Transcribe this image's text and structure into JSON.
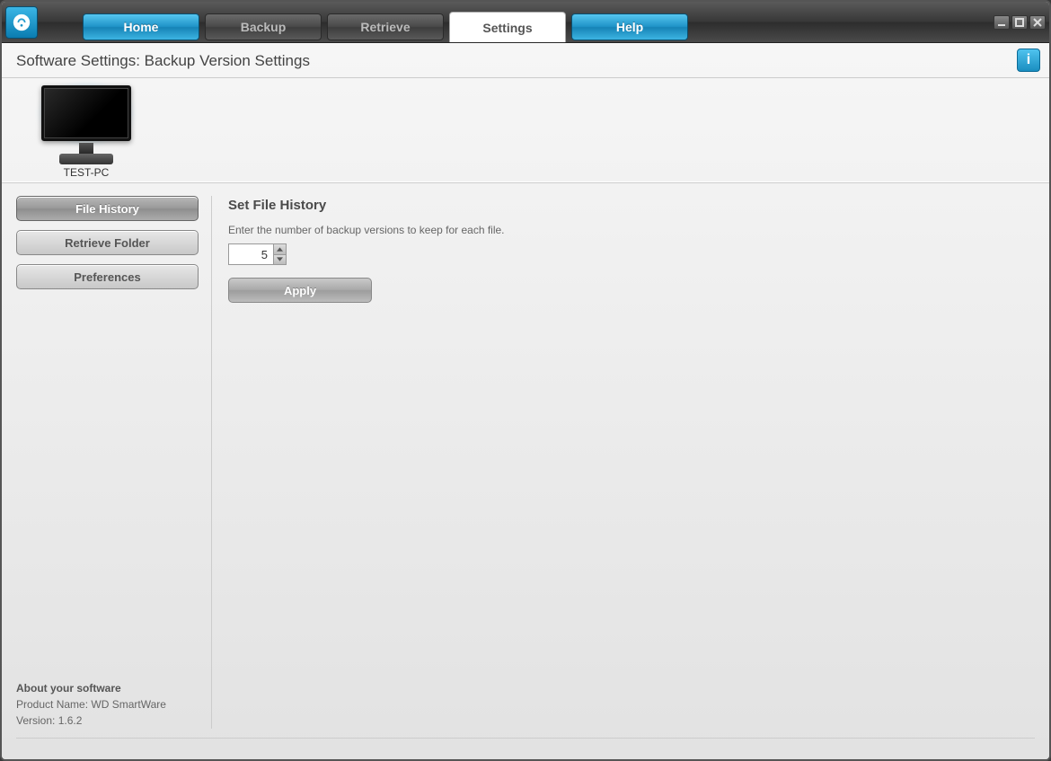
{
  "tabs": {
    "home": "Home",
    "backup": "Backup",
    "retrieve": "Retrieve",
    "settings": "Settings",
    "help": "Help"
  },
  "page_title": "Software Settings: Backup Version Settings",
  "info_icon_text": "i",
  "device": {
    "name": "TEST-PC"
  },
  "sidebar": {
    "items": [
      {
        "label": "File History"
      },
      {
        "label": "Retrieve Folder"
      },
      {
        "label": "Preferences"
      }
    ]
  },
  "main": {
    "heading": "Set File History",
    "description": "Enter the number of backup versions to keep for each file.",
    "value": "5",
    "apply_label": "Apply"
  },
  "about": {
    "heading": "About your software",
    "product_label": "Product Name: ",
    "product_value": "WD SmartWare",
    "version_label": "Version: ",
    "version_value": "1.6.2"
  }
}
